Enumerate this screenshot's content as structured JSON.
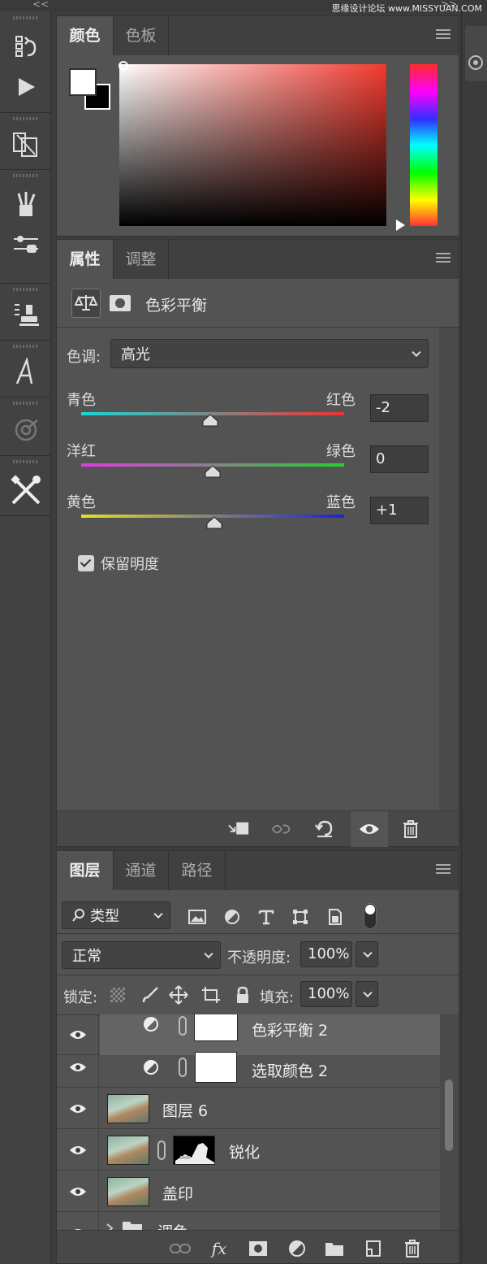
{
  "top": {
    "left_collapse": "<<",
    "right_collapse": ">>",
    "watermark": "思缘设计论坛 www.MISSYUAN.COM"
  },
  "color_panel": {
    "tabs": [
      {
        "label": "颜色"
      },
      {
        "label": "色板"
      }
    ],
    "foreground": "#ffffff",
    "background": "#000000",
    "picker_hue": "#f23a2e"
  },
  "properties_panel": {
    "tabs": [
      {
        "label": "属性"
      },
      {
        "label": "调整"
      }
    ],
    "adjustment_title": "色彩平衡",
    "tone_label": "色调:",
    "tone_value": "高光",
    "sliders": [
      {
        "left": "青色",
        "right": "红色",
        "value": "-2",
        "fraction": 0.49
      },
      {
        "left": "洋红",
        "right": "绿色",
        "value": "0",
        "fraction": 0.5
      },
      {
        "left": "黄色",
        "right": "蓝色",
        "value": "+1",
        "fraction": 0.505
      }
    ],
    "preserve_luminosity": "保留明度"
  },
  "layers_panel": {
    "tabs": [
      {
        "label": "图层"
      },
      {
        "label": "通道"
      },
      {
        "label": "路径"
      }
    ],
    "filter_label": "类型",
    "blend_mode": "正常",
    "opacity_label": "不透明度:",
    "opacity_value": "100%",
    "lock_label": "锁定:",
    "fill_label": "填充:",
    "fill_value": "100%",
    "layers": [
      {
        "name": "色彩平衡 2"
      },
      {
        "name": "选取颜色 2"
      },
      {
        "name": "图层 6"
      },
      {
        "name": "锐化"
      },
      {
        "name": "盖印"
      },
      {
        "name": "调色"
      }
    ],
    "footer_fx": "fx"
  }
}
